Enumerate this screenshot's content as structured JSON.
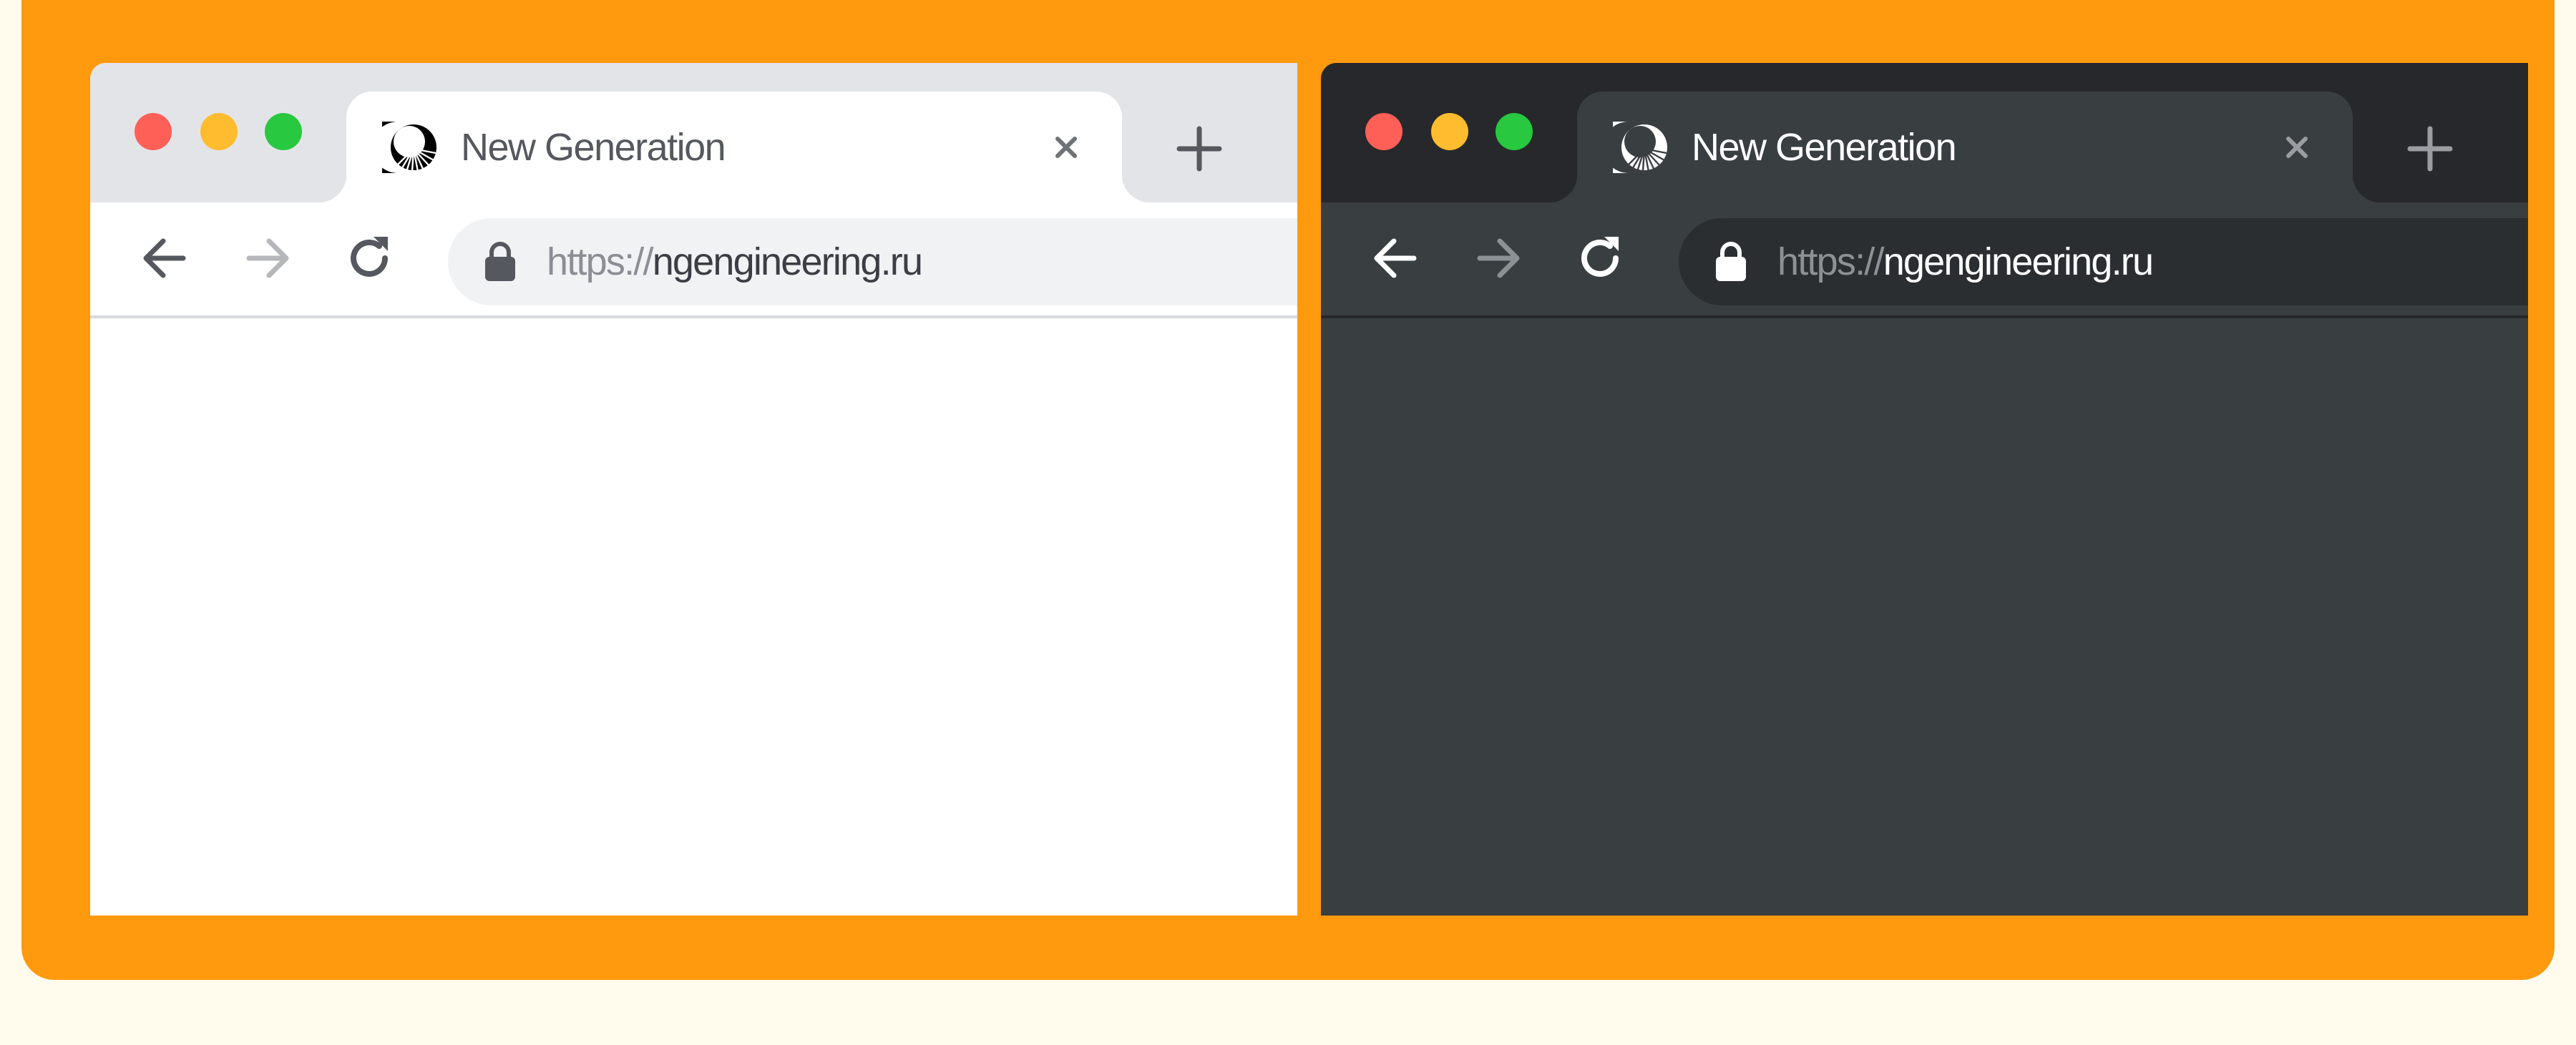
{
  "colors": {
    "page_background": "#fffcee",
    "frame": "#ff9a0e",
    "traffic_red": "#fe5f57",
    "traffic_yellow": "#febc2e",
    "traffic_green": "#28c840",
    "light_tabbar": "#e3e4e8",
    "light_content": "#ffffff",
    "dark_tabbar": "#26282b",
    "dark_content": "#393e41"
  },
  "light_window": {
    "theme": "light",
    "tab": {
      "favicon": "new-generation-logo-icon",
      "title": "New Generation",
      "close_icon": "close-icon"
    },
    "new_tab_icon": "plus-icon",
    "toolbar": {
      "back_icon": "arrow-left-icon",
      "forward_icon": "arrow-right-icon",
      "forward_enabled": false,
      "reload_icon": "reload-icon"
    },
    "address_bar": {
      "lock_icon": "lock-icon",
      "scheme": "https://",
      "host": "ngengineering.ru"
    }
  },
  "dark_window": {
    "theme": "dark",
    "tab": {
      "favicon": "new-generation-logo-icon",
      "title": "New Generation",
      "close_icon": "close-icon"
    },
    "new_tab_icon": "plus-icon",
    "toolbar": {
      "back_icon": "arrow-left-icon",
      "forward_icon": "arrow-right-icon",
      "forward_enabled": false,
      "reload_icon": "reload-icon"
    },
    "address_bar": {
      "lock_icon": "lock-icon",
      "scheme": "https://",
      "host": "ngengineering.ru"
    }
  }
}
